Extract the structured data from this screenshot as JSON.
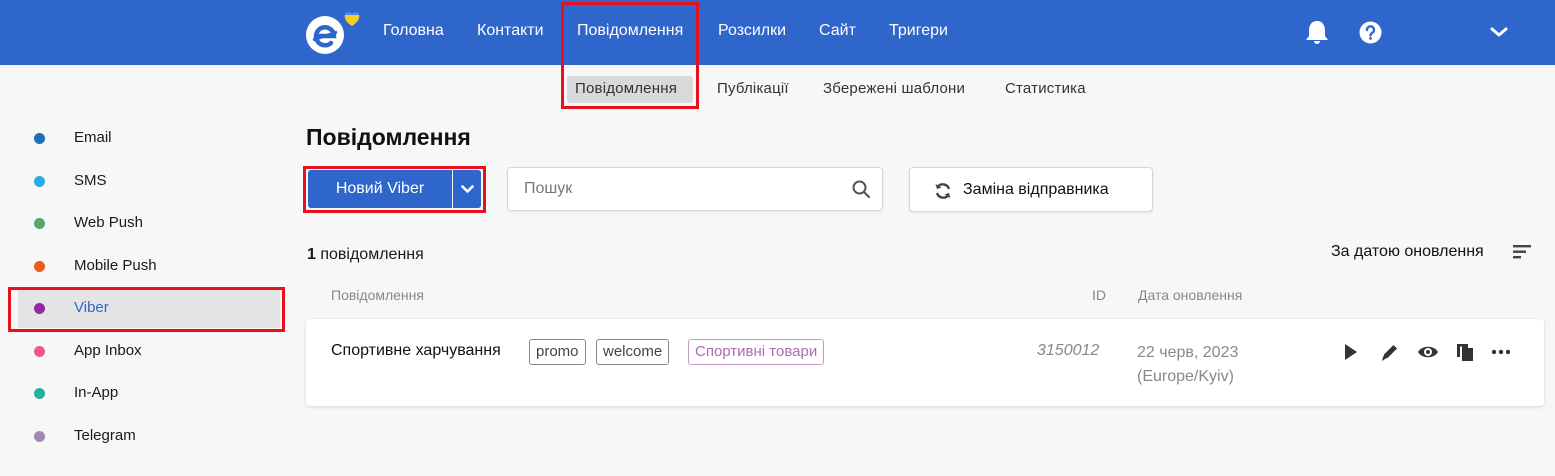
{
  "topnav": {
    "items": [
      "Головна",
      "Контакти",
      "Повідомлення",
      "Розсилки",
      "Сайт",
      "Тригери"
    ]
  },
  "subnav": {
    "items": [
      "Повідомлення",
      "Публікації",
      "Збережені шаблони",
      "Статистика"
    ]
  },
  "sidebar": {
    "items": [
      {
        "label": "Email",
        "color": "#1f6fb8"
      },
      {
        "label": "SMS",
        "color": "#27aee8"
      },
      {
        "label": "Web Push",
        "color": "#56a86a"
      },
      {
        "label": "Mobile Push",
        "color": "#ea5a1c"
      },
      {
        "label": "Viber",
        "color": "#8e2c9c"
      },
      {
        "label": "App Inbox",
        "color": "#ef5a8c"
      },
      {
        "label": "In-App",
        "color": "#22b39a"
      },
      {
        "label": "Telegram",
        "color": "#a08ab4"
      }
    ],
    "active": "Viber"
  },
  "main": {
    "title": "Повідомлення",
    "new_button_label": "Новий Viber",
    "search_placeholder": "Пошук",
    "change_sender_label": "Заміна відправника",
    "count_number": "1",
    "count_text": " повідомлення",
    "sort_label": "За датою оновлення",
    "columns": {
      "message": "Повідомлення",
      "id": "ID",
      "date": "Дата оновлення"
    }
  },
  "messages": [
    {
      "name": "Спортивне харчування",
      "tags": [
        "promo",
        "welcome"
      ],
      "category": "Спортивні товари",
      "id": "3150012",
      "date": "22 черв, 2023",
      "timezone": "(Europe/Kyiv)"
    }
  ],
  "icons": {
    "logo": "esputnik-logo-icon",
    "notifications": "bell-icon",
    "help": "question-circle-icon",
    "account_menu": "chevron-down-icon",
    "search": "search-icon",
    "change_sender": "refresh-icon",
    "sort": "sort-lines-icon",
    "actions": [
      "play-icon",
      "pencil-icon",
      "eye-icon",
      "copy-icon",
      "more-dots-icon"
    ]
  },
  "colors": {
    "brand_blue": "#2f66cc",
    "highlight_red": "#e8101c",
    "page_bg": "#f7f7f7"
  }
}
